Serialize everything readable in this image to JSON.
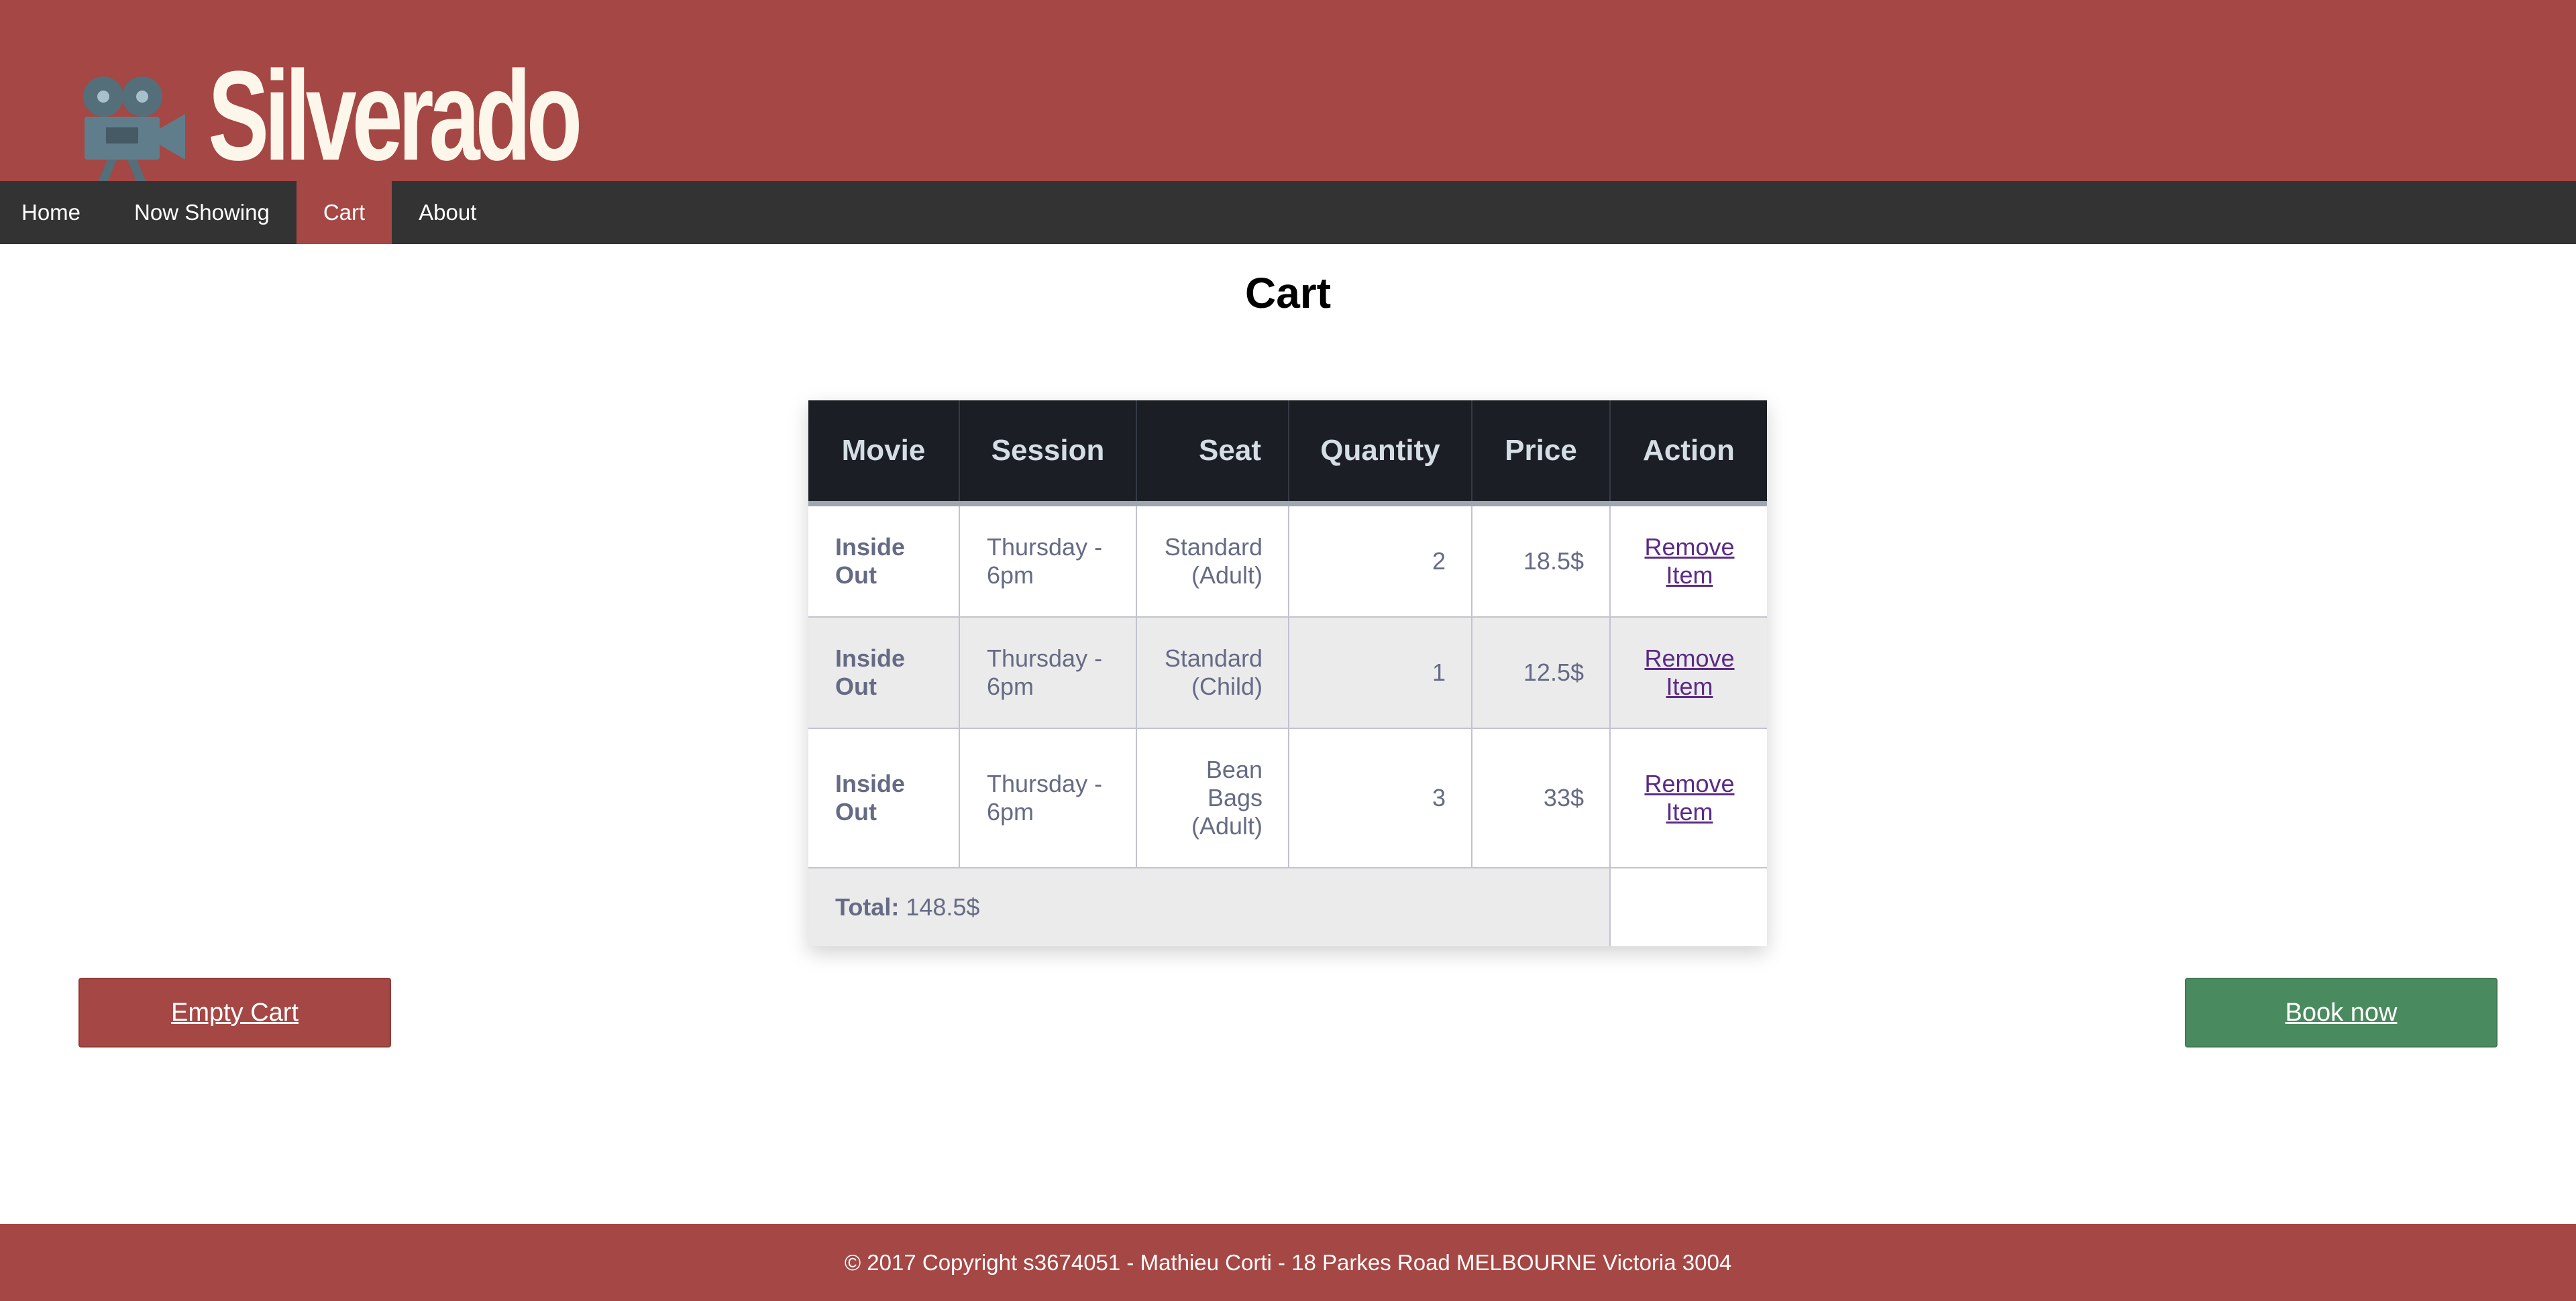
{
  "colors": {
    "brand": "#a54744",
    "nav_bg": "#333333",
    "table_header_bg": "#1b1e24",
    "book_button": "#4a8a5f",
    "link": "#5b2a86"
  },
  "header": {
    "logo_icon": "film-camera-icon",
    "site_title": "Silverado"
  },
  "nav": {
    "items": [
      {
        "label": "Home"
      },
      {
        "label": "Now Showing"
      },
      {
        "label": "Cart",
        "active": true
      },
      {
        "label": "About"
      }
    ]
  },
  "page": {
    "title": "Cart"
  },
  "cart": {
    "columns": [
      "Movie",
      "Session",
      "Seat",
      "Quantity",
      "Price",
      "Action"
    ],
    "rows": [
      {
        "movie": "Inside Out",
        "session": "Thursday - 6pm",
        "seat": "Standard (Adult)",
        "quantity": "2",
        "price": "18.5$",
        "action": "Remove Item"
      },
      {
        "movie": "Inside Out",
        "session": "Thursday - 6pm",
        "seat": "Standard (Child)",
        "quantity": "1",
        "price": "12.5$",
        "action": "Remove Item"
      },
      {
        "movie": "Inside Out",
        "session": "Thursday - 6pm",
        "seat": "Bean Bags (Adult)",
        "quantity": "3",
        "price": "33$",
        "action": "Remove Item"
      }
    ],
    "total_label": "Total:",
    "total_value": "148.5$"
  },
  "buttons": {
    "empty_cart": "Empty Cart",
    "book_now": "Book now"
  },
  "footer": {
    "text": "© 2017 Copyright s3674051 - Mathieu Corti - 18 Parkes Road MELBOURNE Victoria 3004"
  }
}
